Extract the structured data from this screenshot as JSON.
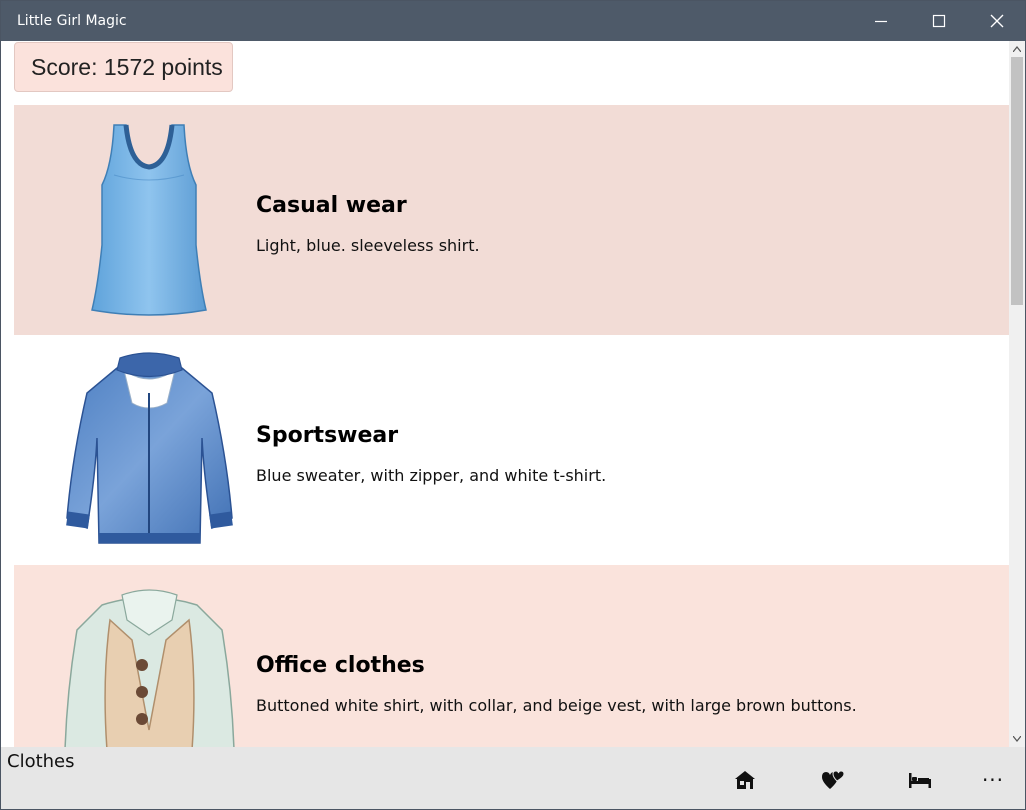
{
  "window": {
    "title": "Little Girl Magic"
  },
  "score": {
    "label": "Score: 1572 points"
  },
  "items": [
    {
      "title": "Casual wear",
      "description": "Light, blue. sleeveless shirt.",
      "image": "sleeveless-blue-top",
      "background": "#f2dcd6"
    },
    {
      "title": "Sportswear",
      "description": "Blue sweater, with zipper, and white t-shirt.",
      "image": "blue-zip-sweater",
      "background": "#ffffff"
    },
    {
      "title": "Office clothes",
      "description": "Buttoned white shirt, with collar, and beige vest, with large brown buttons.",
      "image": "shirt-beige-vest",
      "background": "#fae3dc"
    }
  ],
  "bottombar": {
    "label": "Clothes",
    "buttons": [
      "house-icon",
      "hearts-icon",
      "bed-icon",
      "more-icon"
    ],
    "more_label": "···"
  },
  "colors": {
    "titlebar": "#4e5a69",
    "score_bg": "#fbe2dc",
    "bottombar": "#e6e6e6"
  }
}
